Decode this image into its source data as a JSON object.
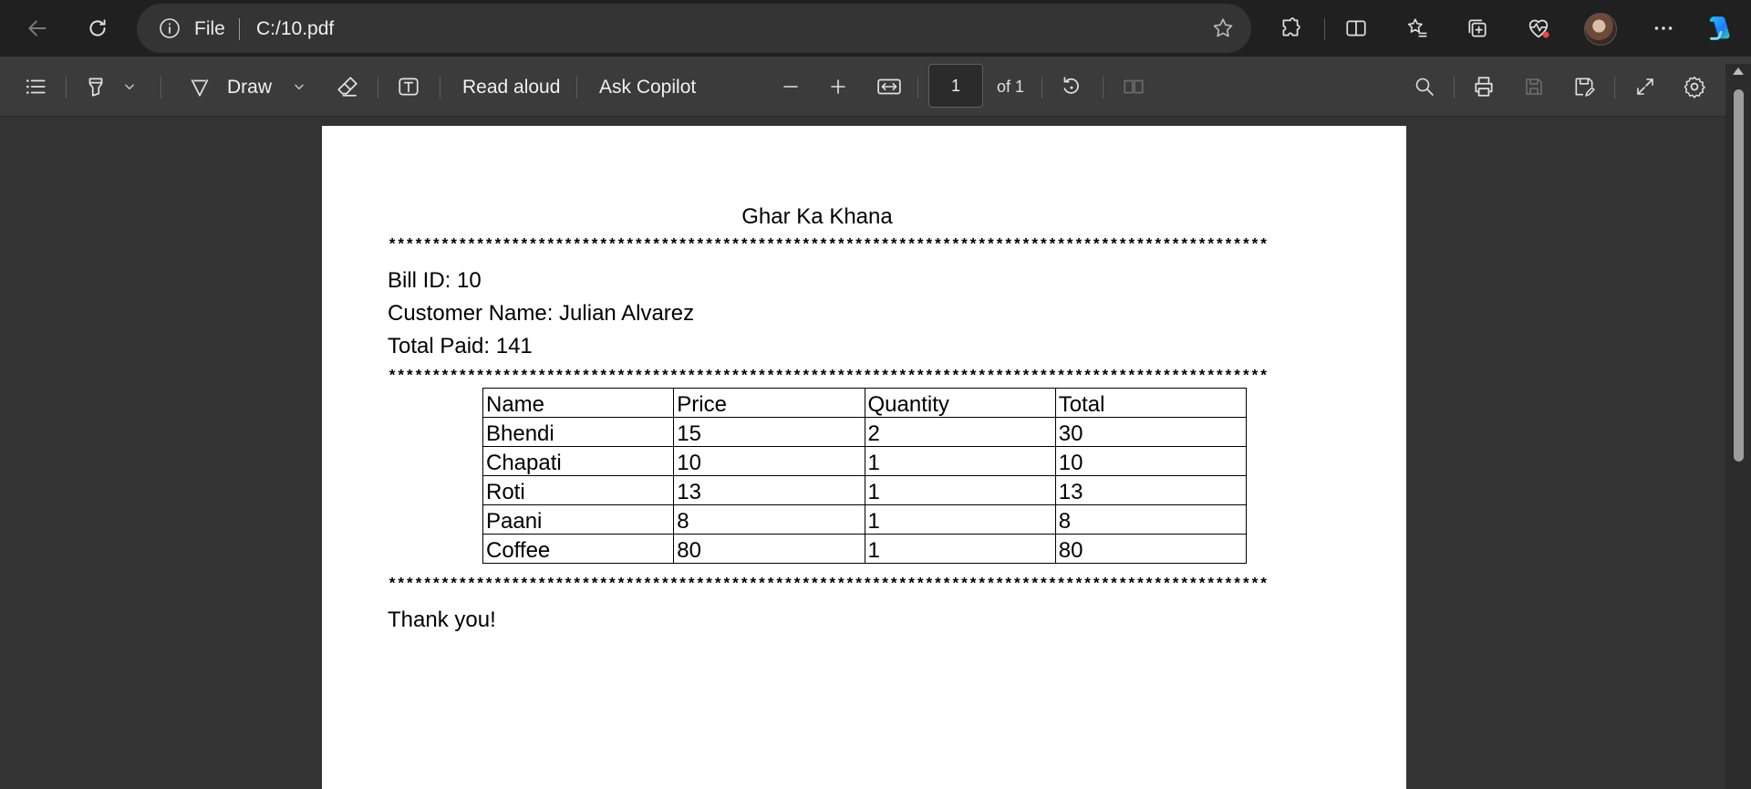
{
  "browser": {
    "address": {
      "scheme_label": "File",
      "url": "C:/10.pdf"
    }
  },
  "pdf_toolbar": {
    "draw_label": "Draw",
    "read_aloud_label": "Read aloud",
    "ask_copilot_label": "Ask Copilot",
    "page_number": "1",
    "page_total": "of 1"
  },
  "document": {
    "title": "Ghar Ka Khana",
    "separator": "****************************************************************************************************",
    "bill_id": "Bill ID: 10",
    "customer": "Customer Name: Julian Alvarez",
    "total_paid": "Total Paid: 141",
    "table": {
      "headers": [
        "Name",
        "Price",
        "Quantity",
        "Total"
      ],
      "rows": [
        [
          "Bhendi",
          "15",
          "2",
          "30"
        ],
        [
          "Chapati",
          "10",
          "1",
          "10"
        ],
        [
          "Roti",
          "13",
          "1",
          "13"
        ],
        [
          "Paani",
          "8",
          "1",
          "8"
        ],
        [
          "Coffee",
          "80",
          "1",
          "80"
        ]
      ]
    },
    "footer": "Thank you!"
  },
  "colors": {
    "titlebar_bg": "#202020",
    "toolbar_bg": "#3b3b3b",
    "viewer_bg": "#333333",
    "page_bg": "#ffffff",
    "copilot_accent": "#1aa3ff"
  }
}
